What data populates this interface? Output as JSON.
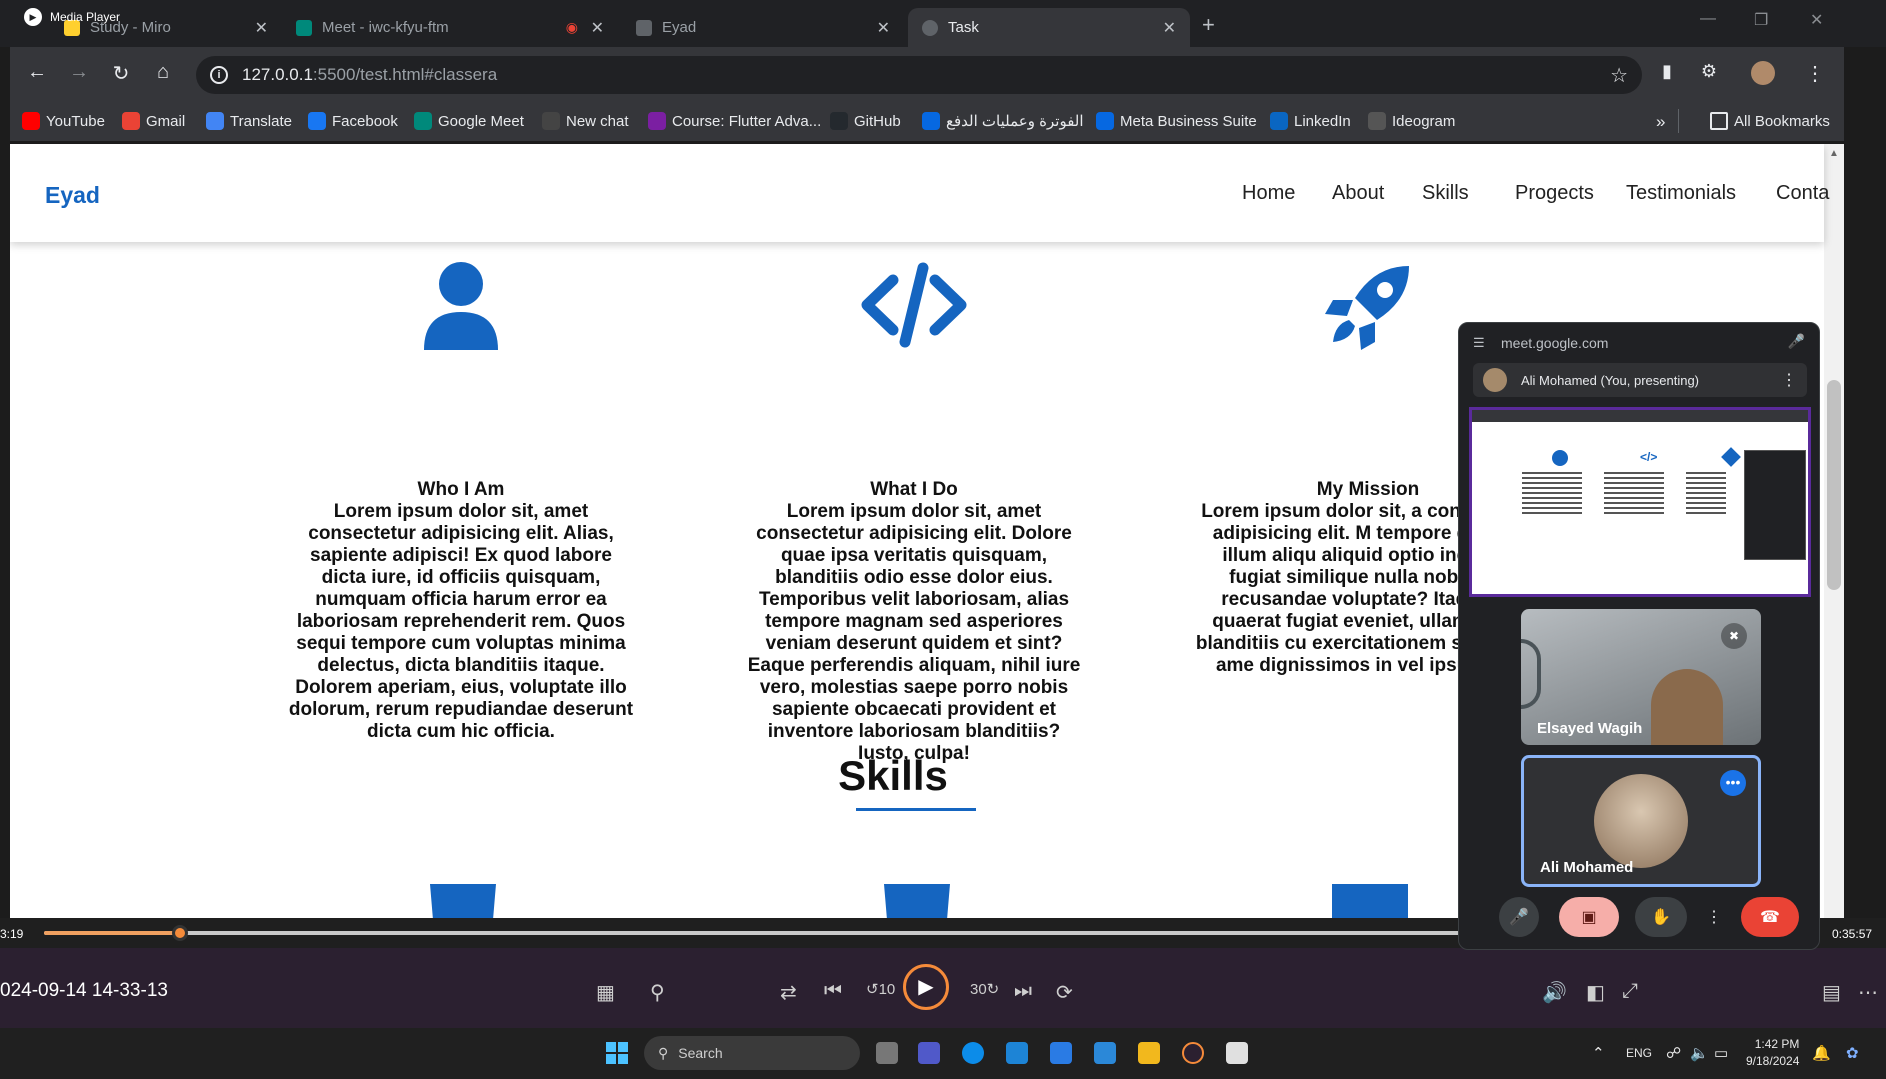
{
  "media_player": {
    "title": "Media Player",
    "current_time": "3:19",
    "total_time": "0:35:57",
    "progress": 0.077,
    "recording_timestamp": "024-09-14 14-33-13"
  },
  "browser": {
    "tabs": [
      {
        "label": "Study - Miro",
        "active": false
      },
      {
        "label": "Meet - iwc-kfyu-ftm",
        "active": false
      },
      {
        "label": "Eyad",
        "active": false
      },
      {
        "label": "Task",
        "active": true
      }
    ],
    "url_host": "127.0.0.1",
    "url_rest": ":5500/test.html#classera",
    "bookmarks": [
      {
        "label": "YouTube",
        "icon": "youtube-icon",
        "color": "#ff0000"
      },
      {
        "label": "Gmail",
        "icon": "gmail-icon",
        "color": "#ea4335"
      },
      {
        "label": "Translate",
        "icon": "translate-icon",
        "color": "#4285f4"
      },
      {
        "label": "Facebook",
        "icon": "facebook-icon",
        "color": "#1877f2"
      },
      {
        "label": "Google Meet",
        "icon": "meet-icon",
        "color": "#00897b"
      },
      {
        "label": "New chat",
        "icon": "chatgpt-icon",
        "color": "#444444"
      },
      {
        "label": "Course: Flutter Adva...",
        "icon": "course-icon",
        "color": "#7b1fa2"
      },
      {
        "label": "GitHub",
        "icon": "github-icon",
        "color": "#24292e"
      },
      {
        "label": "الفوترة وعمليات الدفع",
        "icon": "meta-icon",
        "color": "#0668e1"
      },
      {
        "label": "Meta Business Suite",
        "icon": "meta-icon",
        "color": "#0668e1"
      },
      {
        "label": "LinkedIn",
        "icon": "linkedin-icon",
        "color": "#0a66c2"
      },
      {
        "label": "Ideogram",
        "icon": "ideogram-icon",
        "color": "#555555"
      }
    ],
    "all_bookmarks_label": "All Bookmarks"
  },
  "site": {
    "logo": "Eyad",
    "nav": [
      "Home",
      "About",
      "Skills",
      "Progects",
      "Testimonials",
      "Conta"
    ],
    "cards": [
      {
        "icon": "user-icon",
        "title": "Who I Am",
        "text": "Lorem ipsum dolor sit, amet consectetur adipisicing elit. Alias, sapiente adipisci! Ex quod labore dicta iure, id officiis quisquam, numquam officia harum error ea laboriosam reprehenderit rem. Quos sequi tempore cum voluptas minima delectus, dicta blanditiis itaque. Dolorem aperiam, eius, voluptate illo dolorum, rerum repudiandae deserunt dicta cum hic officia."
      },
      {
        "icon": "code-icon",
        "title": "What I Do",
        "text": "Lorem ipsum dolor sit, amet consectetur adipisicing elit. Dolore quae ipsa veritatis quisquam, blanditiis odio esse dolor eius. Temporibus velit laboriosam, alias tempore magnam sed asperiores veniam deserunt quidem et sint? Eaque perferendis aliquam, nihil iure vero, molestias saepe porro nobis sapiente obcaecati provident et inventore laboriosam blanditiis? Iusto, culpa!"
      },
      {
        "icon": "rocket-icon",
        "title": "My Mission",
        "text": "Lorem ipsum dolor sit, a consectetur adipisicing elit. M tempore deleniti illum aliqu aliquid optio incidunt fugiat similique nulla nobis, su recusandae voluptate? Itaq alias quaerat fugiat eveniet, ullam animi blanditiis cu exercitationem sed. Fuga ame dignissimos in vel ipsum rati"
      }
    ],
    "skills_title": "Skills",
    "skill_icons": [
      "html5-icon",
      "css3-icon",
      "js-icon"
    ],
    "accent": "#1565c0"
  },
  "meet": {
    "url": "meet.google.com",
    "presenter": "Ali Mohamed (You, presenting)",
    "participants": [
      "Elsayed Wagih",
      "Ali Mohamed"
    ]
  },
  "taskbar": {
    "search_placeholder": "Search",
    "lang": "ENG",
    "time": "1:42 PM",
    "date": "9/18/2024"
  }
}
